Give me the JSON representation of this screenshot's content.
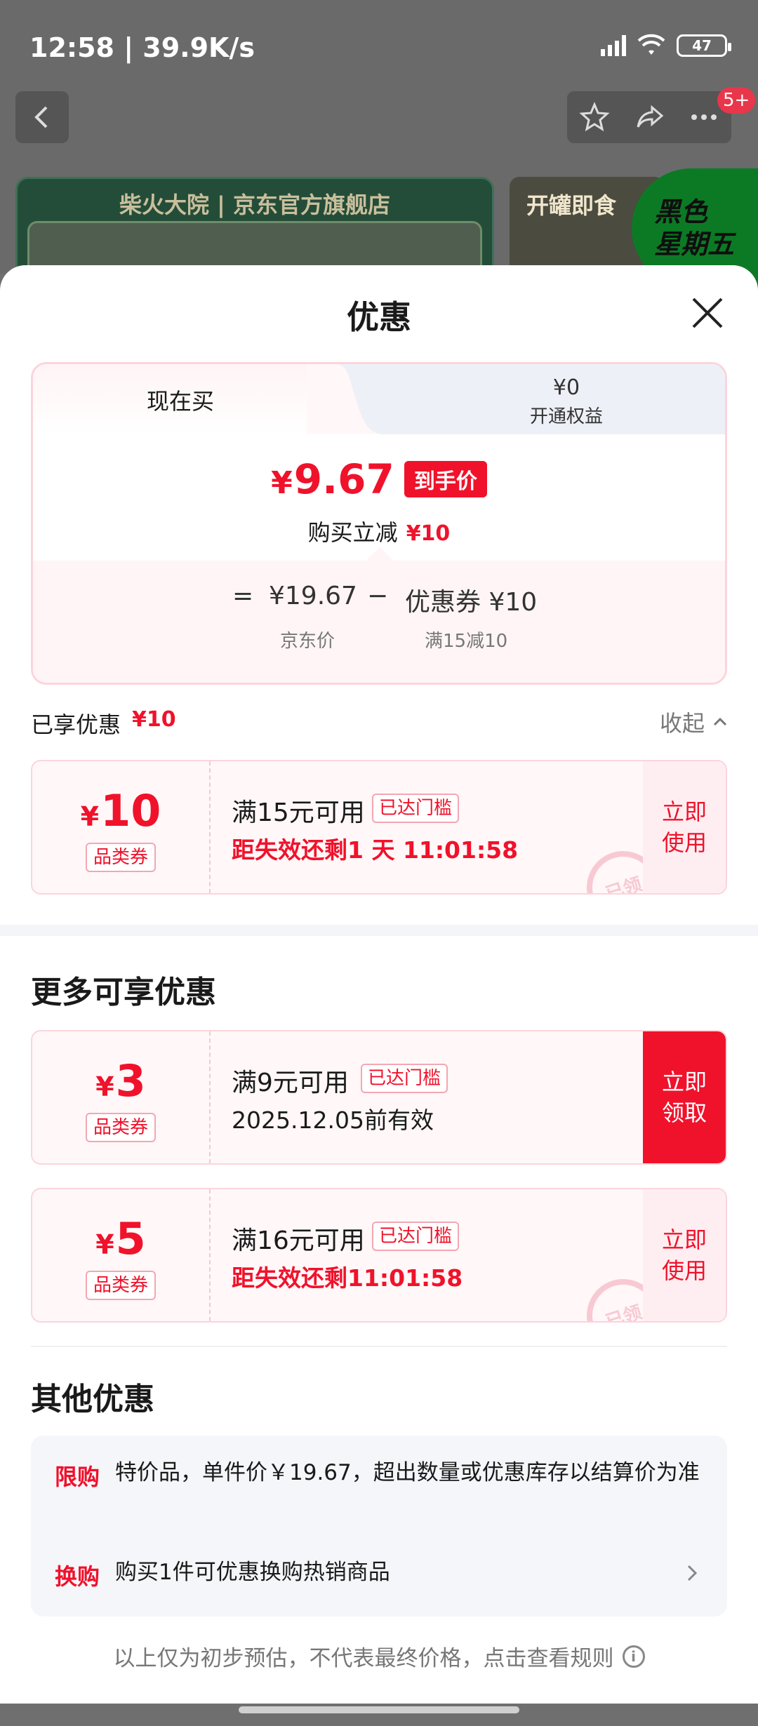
{
  "status": {
    "time": "12:58 | 39.9K/s",
    "battery": "47"
  },
  "page": {
    "badge": "5+",
    "banner_text": "柴火大院 | 京东官方旗舰店",
    "promo_text": "开罐即食",
    "black_friday_line1": "黑色",
    "black_friday_line2": "星期五"
  },
  "sheet": {
    "title": "优惠"
  },
  "price_card": {
    "tab_active": "现在买",
    "tab2_price": "¥0",
    "tab2_label": "开通权益",
    "final_yen": "¥",
    "final_price": "9.67",
    "final_tag": "到手价",
    "saving_label": "购买立减",
    "saving_amount": "¥10",
    "eq": "=",
    "jd_price": "¥19.67",
    "minus": "−",
    "coupon_label": "优惠券 ¥10",
    "jd_price_label": "京东价",
    "coupon_rule": "满15减10"
  },
  "enjoyed": {
    "label": "已享优惠",
    "amount": "¥10",
    "collapse": "收起"
  },
  "coupons_enjoyed": [
    {
      "yen": "¥",
      "amount": "10",
      "type": "品类券",
      "condition": "满15元可用",
      "tag": "已达门槛",
      "expire": "距失效还剩1 天 11:01:58",
      "action": "立即使用",
      "stamp": "已领"
    }
  ],
  "more": {
    "title": "更多可享优惠",
    "coupons": [
      {
        "yen": "¥",
        "amount": "3",
        "type": "品类券",
        "condition": "满9元可用",
        "tag": "已达门槛",
        "expire": "2025.12.05前有效",
        "action": "立即领取"
      },
      {
        "yen": "¥",
        "amount": "5",
        "type": "品类券",
        "condition": "满16元可用",
        "tag": "已达门槛",
        "expire": "距失效还剩11:01:58",
        "action": "立即使用",
        "stamp": "已领"
      }
    ]
  },
  "other": {
    "title": "其他优惠",
    "items": [
      {
        "label": "限购",
        "text": "特价品，单件价￥19.67，超出数量或优惠库存以结算价为准"
      },
      {
        "label": "换购",
        "text": "购买1件可优惠换购热销商品"
      }
    ]
  },
  "footer": {
    "note": "以上仅为初步预估，不代表最终价格，点击查看规则"
  },
  "colors": {
    "accent": "#f0122b",
    "coupon_bg": "#fff7f8",
    "border": "#fbd5dc"
  },
  "icons": [
    "back-arrow-icon",
    "star-icon",
    "share-icon",
    "more-dots-icon",
    "close-icon",
    "chevron-up-icon",
    "chevron-right-icon",
    "info-icon",
    "signal-icon",
    "wifi-icon",
    "battery-icon"
  ]
}
